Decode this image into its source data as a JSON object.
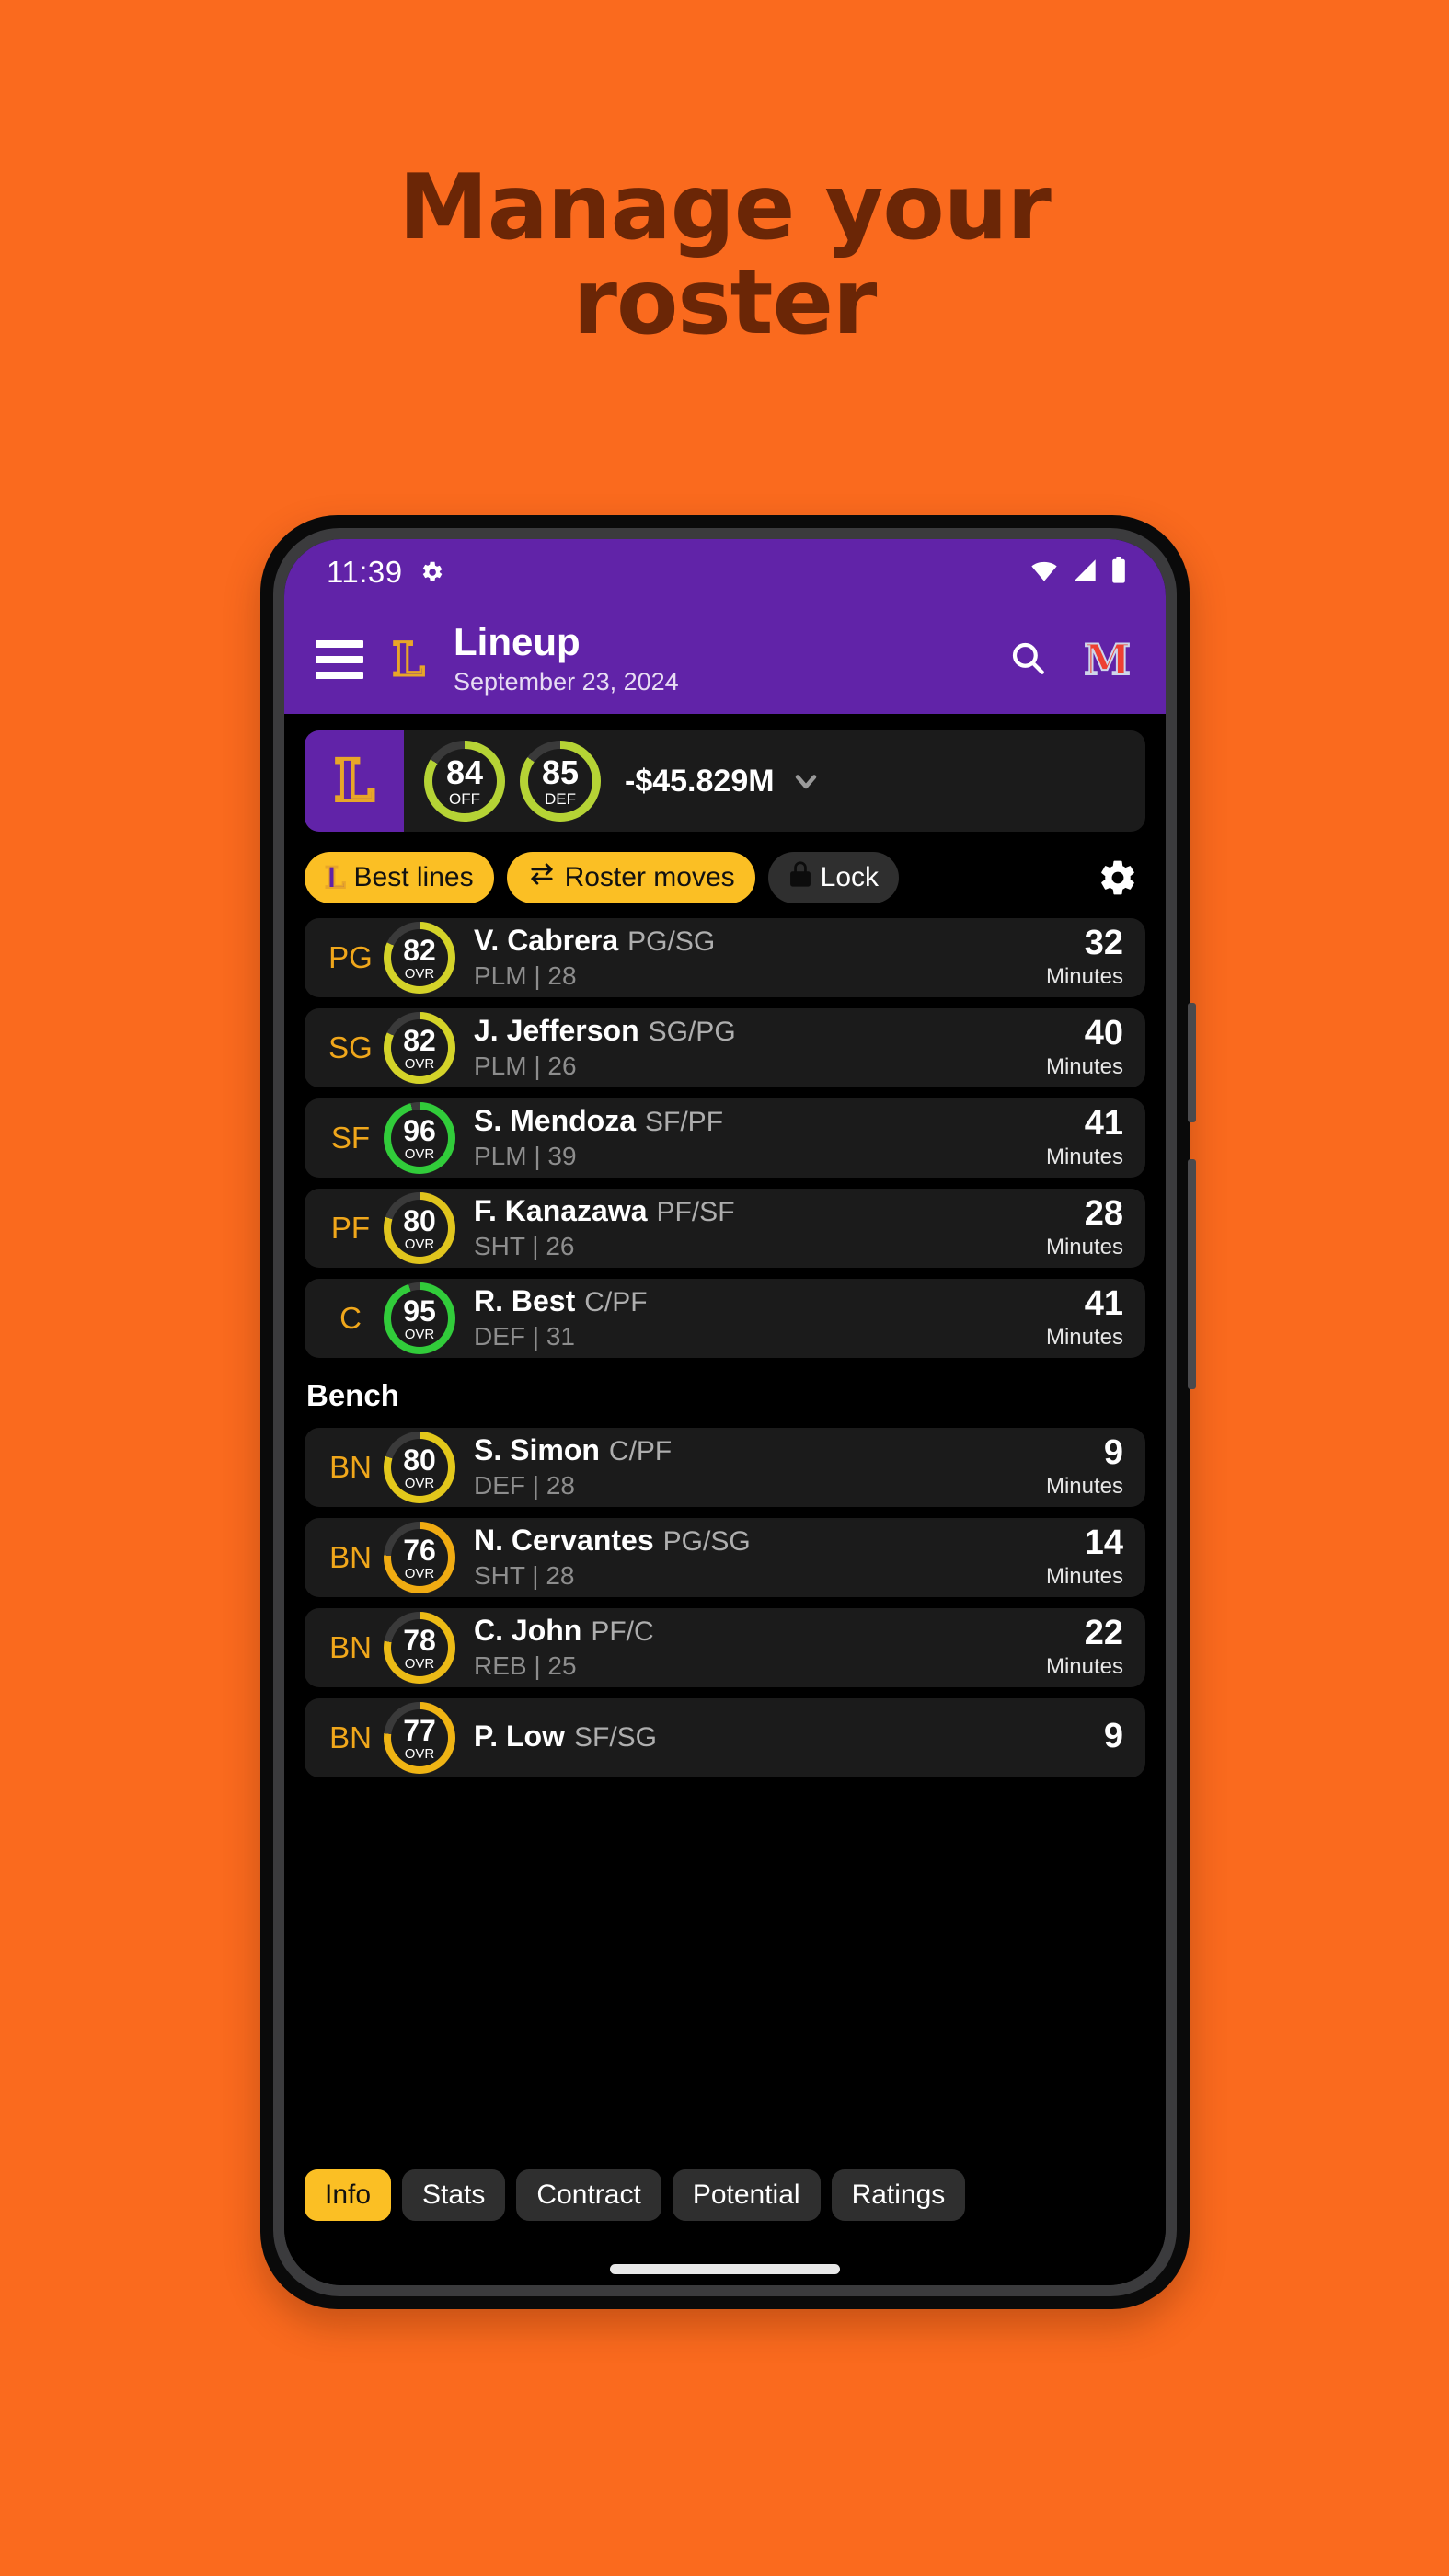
{
  "promo": {
    "line1": "Manage your",
    "line2": "roster",
    "bg_color": "#fa6a1e",
    "text_color": "#6b2606"
  },
  "statusbar": {
    "time": "11:39",
    "icons": [
      "gear-icon",
      "wifi-icon",
      "cellular-signal-icon",
      "battery-icon"
    ]
  },
  "appbar": {
    "menu_icon": "hamburger-menu-icon",
    "team_logo_letter": "L",
    "title": "Lineup",
    "subtitle": "September 23, 2024",
    "search_icon": "search-icon",
    "league_logo_letter": "M",
    "bar_color": "#6123a8"
  },
  "summary": {
    "team_logo_letter": "L",
    "ratings": [
      {
        "value": "84",
        "label": "OFF",
        "ring_color": "#b5d335",
        "pct": 84
      },
      {
        "value": "85",
        "label": "DEF",
        "ring_color": "#b5d335",
        "pct": 85
      }
    ],
    "cap_space": "-$45.829M",
    "expand_icon": "chevron-down-icon"
  },
  "actions": {
    "best_lines": {
      "label": "Best lines",
      "icon": "team-logo-icon"
    },
    "roster_moves": {
      "label": "Roster moves",
      "icon": "swap-arrows-icon"
    },
    "lock": {
      "label": "Lock",
      "icon": "lock-icon"
    },
    "settings_icon": "gear-icon"
  },
  "roster": {
    "starters": [
      {
        "pos": "PG",
        "ovr": "82",
        "ovr_label": "OVR",
        "ring_color": "#d4d329",
        "pct": 82,
        "name": "V. Cabrera",
        "positions": "PG/SG",
        "detail": "PLM | 28",
        "minutes": "32",
        "minutes_label": "Minutes"
      },
      {
        "pos": "SG",
        "ovr": "82",
        "ovr_label": "OVR",
        "ring_color": "#d4d329",
        "pct": 82,
        "name": "J. Jefferson",
        "positions": "SG/PG",
        "detail": "PLM | 26",
        "minutes": "40",
        "minutes_label": "Minutes"
      },
      {
        "pos": "SF",
        "ovr": "96",
        "ovr_label": "OVR",
        "ring_color": "#31cc3a",
        "pct": 96,
        "name": "S. Mendoza",
        "positions": "SF/PF",
        "detail": "PLM | 39",
        "minutes": "41",
        "minutes_label": "Minutes"
      },
      {
        "pos": "PF",
        "ovr": "80",
        "ovr_label": "OVR",
        "ring_color": "#e0c51d",
        "pct": 80,
        "name": "F. Kanazawa",
        "positions": "PF/SF",
        "detail": "SHT | 26",
        "minutes": "28",
        "minutes_label": "Minutes"
      },
      {
        "pos": "C",
        "ovr": "95",
        "ovr_label": "OVR",
        "ring_color": "#31cc3a",
        "pct": 95,
        "name": "R. Best",
        "positions": "C/PF",
        "detail": "DEF | 31",
        "minutes": "41",
        "minutes_label": "Minutes"
      }
    ],
    "bench_header": "Bench",
    "bench": [
      {
        "pos": "BN",
        "ovr": "80",
        "ovr_label": "OVR",
        "ring_color": "#e3c81b",
        "pct": 80,
        "name": "S. Simon",
        "positions": "C/PF",
        "detail": "DEF | 28",
        "minutes": "9",
        "minutes_label": "Minutes"
      },
      {
        "pos": "BN",
        "ovr": "76",
        "ovr_label": "OVR",
        "ring_color": "#f0ab12",
        "pct": 76,
        "name": "N. Cervantes",
        "positions": "PG/SG",
        "detail": "SHT | 28",
        "minutes": "14",
        "minutes_label": "Minutes"
      },
      {
        "pos": "BN",
        "ovr": "78",
        "ovr_label": "OVR",
        "ring_color": "#ecbb16",
        "pct": 78,
        "name": "C. John",
        "positions": "PF/C",
        "detail": "REB | 25",
        "minutes": "22",
        "minutes_label": "Minutes"
      },
      {
        "pos": "BN",
        "ovr": "77",
        "ovr_label": "OVR",
        "ring_color": "#efb414",
        "pct": 77,
        "name": "P. Low",
        "positions": "SF/SG",
        "detail": "",
        "minutes": "9",
        "minutes_label": ""
      }
    ]
  },
  "tabs": [
    {
      "label": "Info",
      "active": true
    },
    {
      "label": "Stats",
      "active": false
    },
    {
      "label": "Contract",
      "active": false
    },
    {
      "label": "Potential",
      "active": false
    },
    {
      "label": "Ratings",
      "active": false
    }
  ]
}
